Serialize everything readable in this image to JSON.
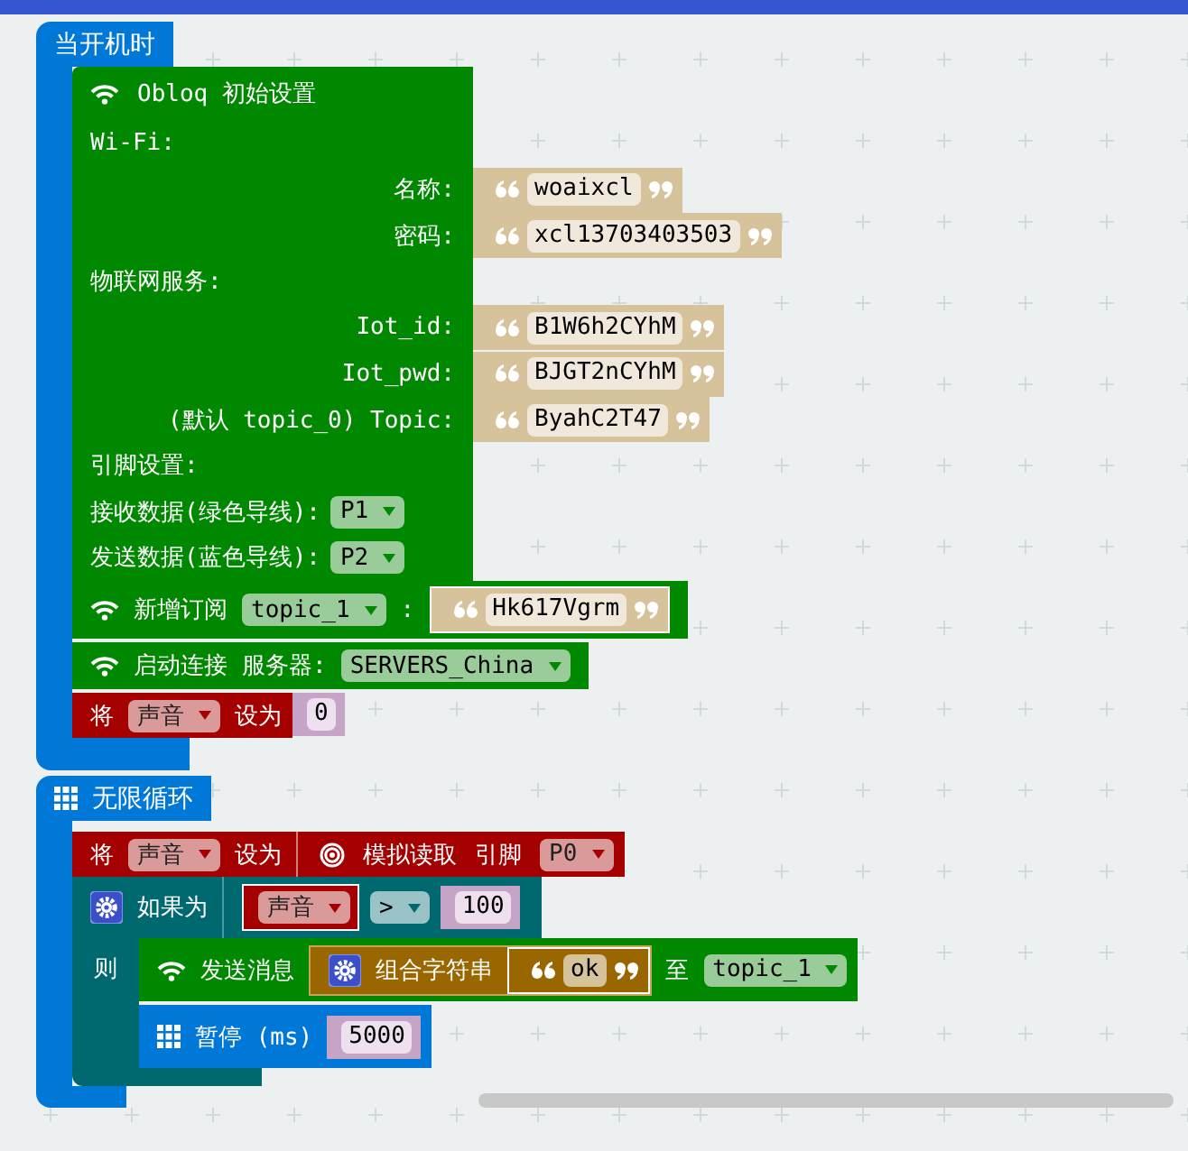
{
  "on_start": {
    "label": "当开机时",
    "obloq_setup": {
      "title": "Obloq 初始设置",
      "sections": [
        {
          "heading": "Wi-Fi:",
          "fields": [
            {
              "label": "名称:",
              "value": "woaixcl"
            },
            {
              "label": "密码:",
              "value": "xcl13703403503"
            }
          ]
        },
        {
          "heading": "物联网服务:",
          "fields": [
            {
              "label": "Iot_id:",
              "value": "B1W6h2CYhM"
            },
            {
              "label": "Iot_pwd:",
              "value": "BJGT2nCYhM"
            },
            {
              "label": "(默认 topic_0) Topic:",
              "value": "ByahC2T47"
            }
          ]
        },
        {
          "heading": "引脚设置:",
          "pins": [
            {
              "label": "接收数据(绿色导线):",
              "value": "P1"
            },
            {
              "label": "发送数据(蓝色导线):",
              "value": "P2"
            }
          ]
        }
      ]
    },
    "subscribe": {
      "label": "新增订阅",
      "topic": "topic_1",
      "separator": ":",
      "value": "Hk617Vgrm"
    },
    "connect": {
      "label": "启动连接",
      "server_label": "服务器:",
      "server": "SERVERS_China"
    },
    "set_var": {
      "label": "将",
      "variable": "声音",
      "to": "设为",
      "value": "0"
    }
  },
  "forever": {
    "label": "无限循环",
    "set_var": {
      "label": "将",
      "variable": "声音",
      "to": "设为",
      "read_label": "模拟读取",
      "pin_label": "引脚",
      "pin": "P0"
    },
    "if": {
      "label": "如果为",
      "variable": "声音",
      "operator": ">",
      "value": "100",
      "then": "则",
      "send": {
        "label": "发送消息",
        "join_label": "组合字符串",
        "text": "ok",
        "to": "至",
        "topic": "topic_1"
      },
      "pause": {
        "label": "暂停 (ms)",
        "value": "5000"
      }
    }
  }
}
